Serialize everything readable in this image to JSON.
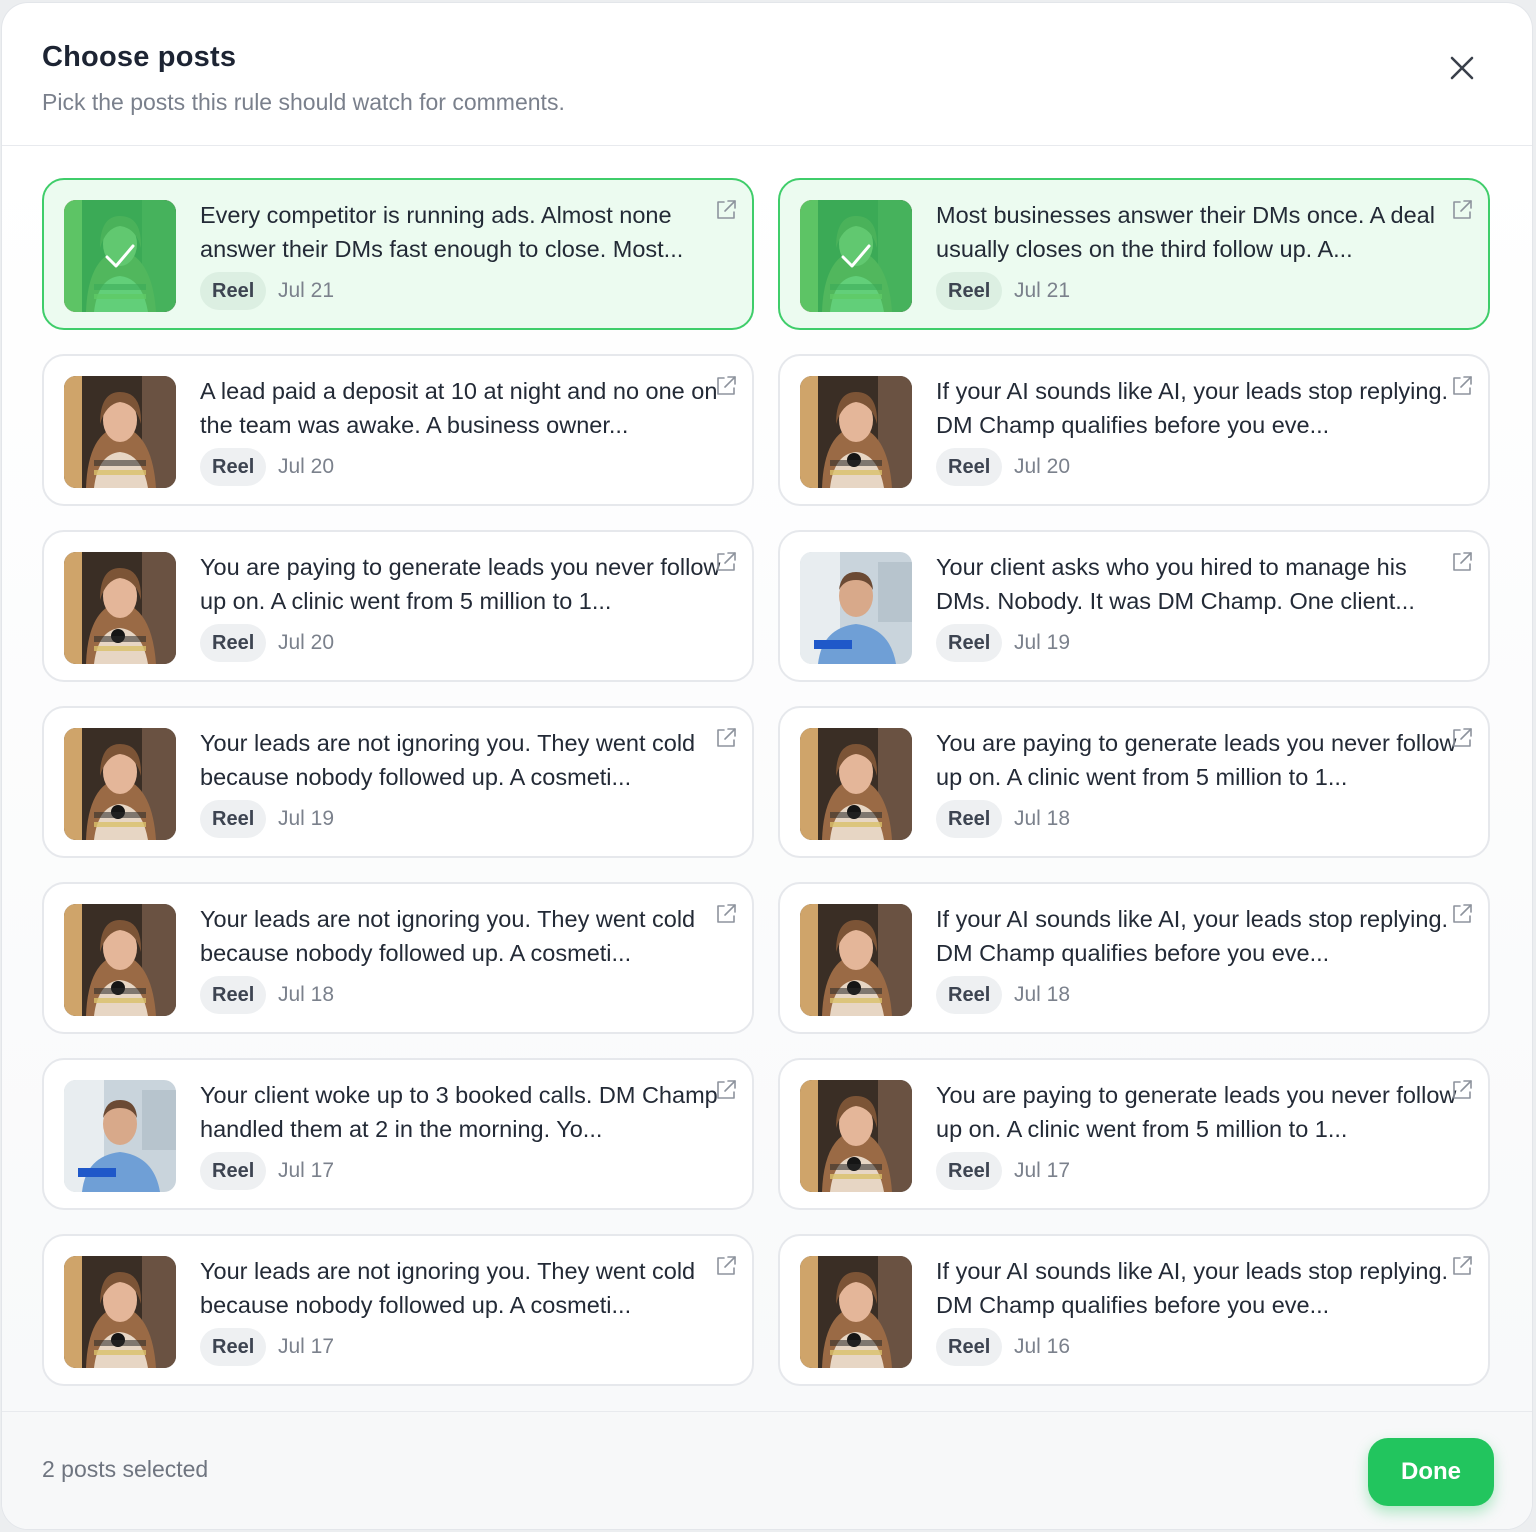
{
  "modal": {
    "title": "Choose posts",
    "subtitle": "Pick the posts this rule should watch for comments."
  },
  "posts": [
    {
      "caption": "Every competitor is running ads. Almost none answer their DMs fast enough to close. Most...",
      "type": "Reel",
      "date": "Jul 21",
      "selected": true,
      "thumb": "woman"
    },
    {
      "caption": "Most businesses answer their DMs once. A deal usually closes on the third follow up. A...",
      "type": "Reel",
      "date": "Jul 21",
      "selected": true,
      "thumb": "woman"
    },
    {
      "caption": "A lead paid a deposit at 10 at night and no one on the team was awake. A business owner...",
      "type": "Reel",
      "date": "Jul 20",
      "selected": false,
      "thumb": "woman"
    },
    {
      "caption": "If your AI sounds like AI, your leads stop replying. DM Champ qualifies before you eve...",
      "type": "Reel",
      "date": "Jul 20",
      "selected": false,
      "thumb": "woman-mic"
    },
    {
      "caption": "You are paying to generate leads you never follow up on. A clinic went from 5 million to 1...",
      "type": "Reel",
      "date": "Jul 20",
      "selected": false,
      "thumb": "woman-mic"
    },
    {
      "caption": "Your client asks who you hired to manage his DMs. Nobody. It was DM Champ. One client...",
      "type": "Reel",
      "date": "Jul 19",
      "selected": false,
      "thumb": "man"
    },
    {
      "caption": "Your leads are not ignoring you. They went cold because nobody followed up. A cosmeti...",
      "type": "Reel",
      "date": "Jul 19",
      "selected": false,
      "thumb": "woman-mic"
    },
    {
      "caption": "You are paying to generate leads you never follow up on. A clinic went from 5 million to 1...",
      "type": "Reel",
      "date": "Jul 18",
      "selected": false,
      "thumb": "woman-mic"
    },
    {
      "caption": "Your leads are not ignoring you. They went cold because nobody followed up. A cosmeti...",
      "type": "Reel",
      "date": "Jul 18",
      "selected": false,
      "thumb": "woman-mic"
    },
    {
      "caption": "If your AI sounds like AI, your leads stop replying. DM Champ qualifies before you eve...",
      "type": "Reel",
      "date": "Jul 18",
      "selected": false,
      "thumb": "woman-mic"
    },
    {
      "caption": "Your client woke up to 3 booked calls. DM Champ handled them at 2 in the morning. Yo...",
      "type": "Reel",
      "date": "Jul 17",
      "selected": false,
      "thumb": "man"
    },
    {
      "caption": "You are paying to generate leads you never follow up on. A clinic went from 5 million to 1...",
      "type": "Reel",
      "date": "Jul 17",
      "selected": false,
      "thumb": "woman-mic"
    },
    {
      "caption": "Your leads are not ignoring you. They went cold because nobody followed up. A cosmeti...",
      "type": "Reel",
      "date": "Jul 17",
      "selected": false,
      "thumb": "woman-mic"
    },
    {
      "caption": "If your AI sounds like AI, your leads stop replying. DM Champ qualifies before you eve...",
      "type": "Reel",
      "date": "Jul 16",
      "selected": false,
      "thumb": "woman-mic"
    }
  ],
  "footer": {
    "selected_count": "2 posts selected",
    "done_label": "Done"
  },
  "colors": {
    "accent": "#22c55e",
    "selected_border": "#3fcd6a",
    "selected_bg": "#ecfbf0"
  },
  "icons": {
    "close": "close-icon",
    "external": "external-link-icon",
    "check": "check-icon"
  }
}
